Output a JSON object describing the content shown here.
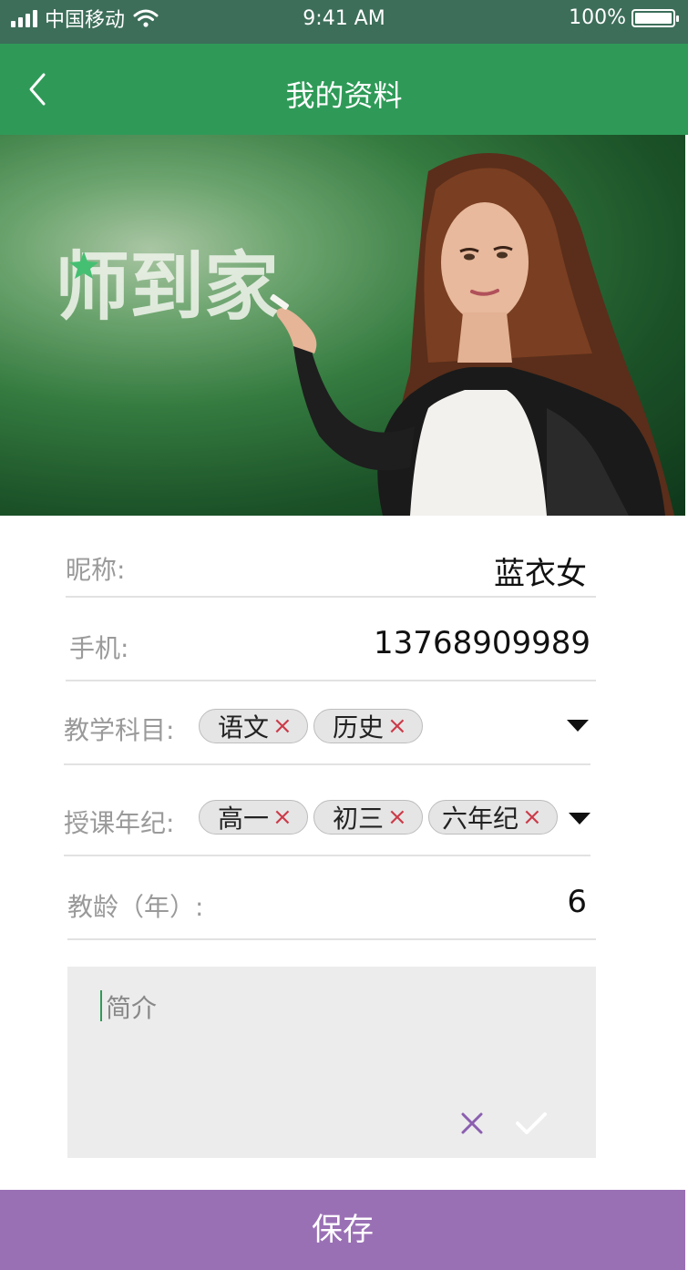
{
  "status_bar": {
    "carrier": "中国移动",
    "time": "9:41 AM",
    "battery": "100%",
    "battery_level": 1.0,
    "icons": [
      "signal-icon",
      "wifi-icon",
      "battery-icon"
    ]
  },
  "nav": {
    "title": "我的资料",
    "back_icon": "chevron-left-icon"
  },
  "hero": {
    "chalk_text": "师到家"
  },
  "form": {
    "nickname": {
      "label": "昵称:",
      "value": "蓝衣女"
    },
    "phone": {
      "label": "手机:",
      "value": "13768909989"
    },
    "subjects": {
      "label": "教学科目:",
      "tags": [
        "语文",
        "历史"
      ]
    },
    "grades": {
      "label": "授课年纪:",
      "tags": [
        "高一",
        "初三",
        "六年纪"
      ]
    },
    "experience": {
      "label": "教龄（年）:",
      "value": "6"
    },
    "intro": {
      "placeholder": "简介"
    }
  },
  "tag_remove_symbol": "×",
  "save_label": "保存",
  "colors": {
    "status_bar": "#3d6e5a",
    "nav_bar": "#2f9a58",
    "save_button": "#9a70b5",
    "tag_remove": "#cc3b4a",
    "intro_cancel": "#8b5fb0"
  }
}
